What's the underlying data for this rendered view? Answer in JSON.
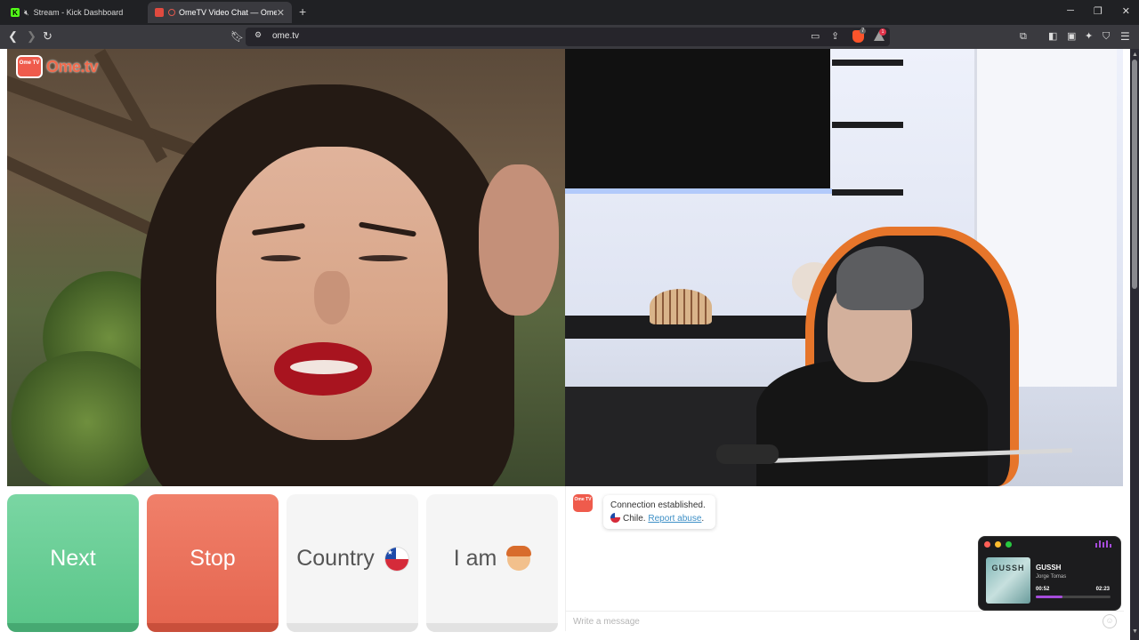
{
  "browser": {
    "tabs": [
      {
        "title": "Stream - Kick Dashboard",
        "active": false,
        "favicon": "kick-logo-icon",
        "muted": true
      },
      {
        "title": "OmeTV Video Chat — Omegl",
        "active": true,
        "favicon": "ometv-favicon-icon",
        "recording": true
      }
    ],
    "url": "ome.tv",
    "brave_shield_count": "7",
    "rewards_count": "1",
    "accent": "#fb542b"
  },
  "site": {
    "logo_box": "Ome TV",
    "logo_text": "Ome.tv"
  },
  "controls": {
    "next_label": "Next",
    "stop_label": "Stop",
    "country_label": "Country",
    "iam_label": "I am",
    "next_color": "#5bc68a",
    "stop_color": "#e56650"
  },
  "chat": {
    "system_line1": "Connection established.",
    "country": "Chile.",
    "report_link": "Report abuse",
    "report_suffix": ".",
    "input_placeholder": "Write a message"
  },
  "player": {
    "cover_text": "GUSSH",
    "song": "GUSSH",
    "artist": "Jorge Tomas",
    "current_time": "00:52",
    "total_time": "02:23",
    "progress_fraction": 0.36,
    "accent": "#a64cdb"
  }
}
